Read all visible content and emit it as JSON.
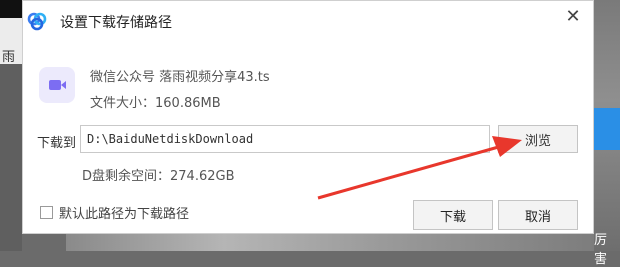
{
  "background": {
    "left_text": "雨",
    "right_text": "厉害"
  },
  "dialog": {
    "title": "设置下载存储路径",
    "close_symbol": "✕",
    "file": {
      "name": "微信公众号 落雨视频分享43.ts",
      "size": "文件大小：160.86MB"
    },
    "path": {
      "label": "下载到",
      "value": "D:\\BaiduNetdiskDownload",
      "browse_label": "浏览"
    },
    "space": "D盘剩余空间：274.62GB",
    "default_checkbox": {
      "label": "默认此路径为下载路径",
      "checked": false
    },
    "buttons": {
      "download": "下载",
      "cancel": "取消"
    }
  },
  "colors": {
    "accent_icon": "#7c6df2",
    "annotation_arrow": "#e8372c"
  },
  "icons": {
    "logo": "baidu-netdisk-logo-icon",
    "file": "video-file-icon",
    "close": "close-icon"
  }
}
